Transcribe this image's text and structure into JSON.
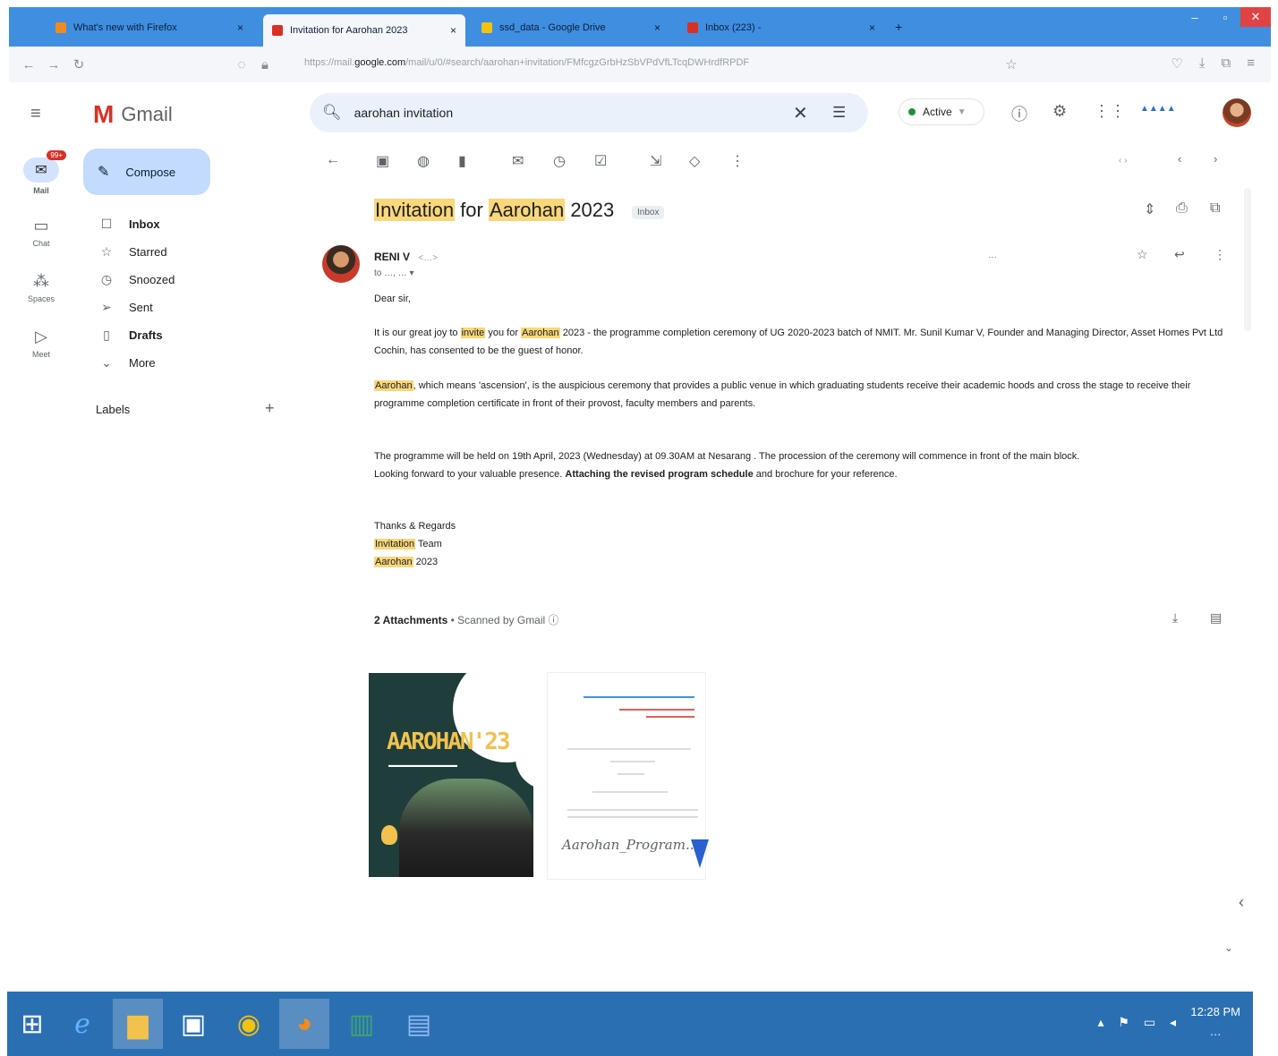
{
  "browser": {
    "tabs": [
      {
        "title": "What's new with Firefox",
        "active": false
      },
      {
        "title": "Invitation for Aarohan 2023",
        "active": true
      },
      {
        "title": "ssd_data - Google Drive",
        "active": false
      },
      {
        "title": "Inbox (223) - ",
        "active": false
      }
    ],
    "url_domain": "google.com"
  },
  "gmail": {
    "app_name": "Gmail",
    "search_value": "aarohan invitation",
    "status": "Active",
    "compose_label": "Compose",
    "rail": [
      {
        "label": "Mail",
        "badge": "99+"
      },
      {
        "label": "Chat"
      },
      {
        "label": "Spaces"
      },
      {
        "label": "Meet"
      }
    ],
    "nav": [
      {
        "label": "Inbox",
        "bold": true
      },
      {
        "label": "Starred",
        "bold": false
      },
      {
        "label": "Snoozed",
        "bold": false
      },
      {
        "label": "Sent",
        "bold": false
      },
      {
        "label": "Drafts",
        "bold": true
      },
      {
        "label": "More",
        "bold": false
      }
    ],
    "labels_heading": "Labels"
  },
  "message": {
    "subject_word1": "Invitation",
    "subject_for": "for",
    "subject_word2": "Aarohan",
    "subject_year": "2023",
    "inbox_chip": "Inbox",
    "sender_name": "RENI V",
    "salutation": "Dear sir,",
    "p1_start": "It is our great joy to",
    "p1_hl1": "invite",
    "p1_mid": "you for",
    "p1_hl2": "Aarohan",
    "p1_end": "2023 - the programme completion ceremony of UG 2020-2023 batch of NMIT. Mr. Sunil Kumar V, Founder and Managing Director, Asset Homes Pvt Ltd Cochin, has consented to be the guest of honor.",
    "p2_hl": "Aarohan",
    "p2_rest": ", which means 'ascension', is the auspicious ceremony that provides a public venue in which graduating students receive their academic hoods and cross the stage to receive their programme completion certificate in front of their provost, faculty members and parents.",
    "p3_line1": "The programme will be held on 19th April, 2023 (Wednesday) at 09.30AM at Nesarang . The procession of the ceremony will commence in front of the main block.",
    "p3_line2_start": "Looking forward to your valuable presence.",
    "p3_line2_bold": "Attaching the revised program schedule",
    "p3_line2_end": "and brochure for your reference.",
    "sign_thanks": "Thanks & Regards",
    "sign_hl1": "Invitation",
    "sign_team": "Team",
    "sign_hl2": "Aarohan",
    "sign_year": "2023",
    "attachments_label": "2 Attachments",
    "scanned_label": "Scanned by Gmail",
    "attachment1_title": "AAROHAN'23",
    "attachment2_name": "Aarohan_Program..."
  },
  "taskbar": {
    "clock_time": "12:28 PM"
  }
}
